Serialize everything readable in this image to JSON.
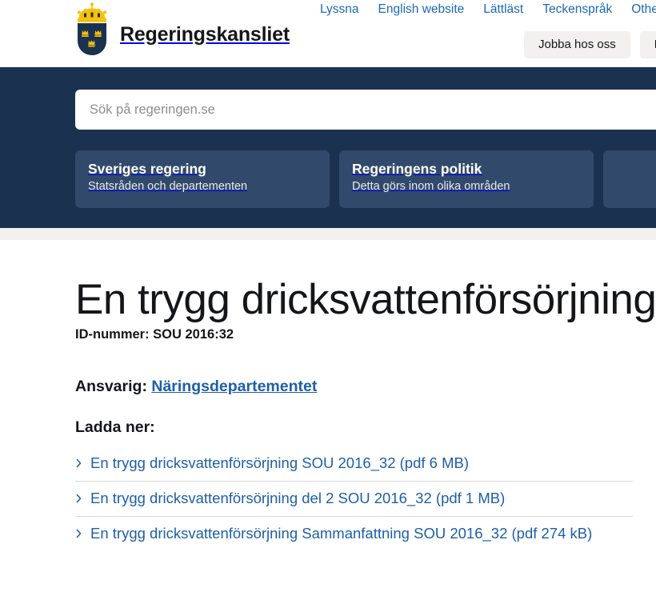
{
  "site": {
    "brand_name": "Regeringskansliet",
    "logo_icon": "swedish-three-crowns-shield-icon"
  },
  "header": {
    "utility_links": [
      {
        "label": "Lyssna",
        "icon": "listen-icon"
      },
      {
        "label": "English website",
        "icon": "globe-icon"
      },
      {
        "label": "Lättläst",
        "icon": "easy-read-icon"
      },
      {
        "label": "Teckenspråk",
        "icon": "sign-language-icon"
      },
      {
        "label": "Other l",
        "icon": "languages-icon"
      }
    ],
    "buttons": [
      {
        "label": "Jobba hos oss"
      },
      {
        "label": "Pre"
      }
    ]
  },
  "search": {
    "placeholder": "Sök på regeringen.se",
    "value": "",
    "icon": "search-icon"
  },
  "nav_cards": [
    {
      "title": "Sveriges regering",
      "subtitle": "Statsråden och departementen"
    },
    {
      "title": "Regeringens politik",
      "subtitle": "Detta görs inom olika områden"
    },
    {
      "title": "",
      "subtitle": ""
    }
  ],
  "main": {
    "title": "En trygg dricksvattenförsörjning",
    "id_number": "ID-nummer: SOU 2016:32",
    "responsible_label": "Ansvarig:",
    "responsible_link": "Näringsdepartementet",
    "download_heading": "Ladda ner:",
    "downloads": [
      {
        "label": "En trygg dricksvattenförsörjning SOU 2016_32 (pdf 6 MB)",
        "icon": "chevron-right-icon"
      },
      {
        "label": "En trygg dricksvattenförsörjning del 2 SOU 2016_32 (pdf 1 MB)",
        "icon": "chevron-right-icon"
      },
      {
        "label": "En trygg dricksvattenförsörjning Sammanfattning SOU 2016_32 (pdf 274 kB)",
        "icon": "chevron-right-icon"
      }
    ]
  },
  "colors": {
    "navy_band": "#1b3150",
    "card": "#314a6b",
    "link_blue": "#1d5fa8",
    "utility_link_blue": "#1d69b4",
    "grey_strip": "#f2f1ef",
    "crown_gold": "#f7c10a",
    "shield_navy": "#1b3150"
  }
}
